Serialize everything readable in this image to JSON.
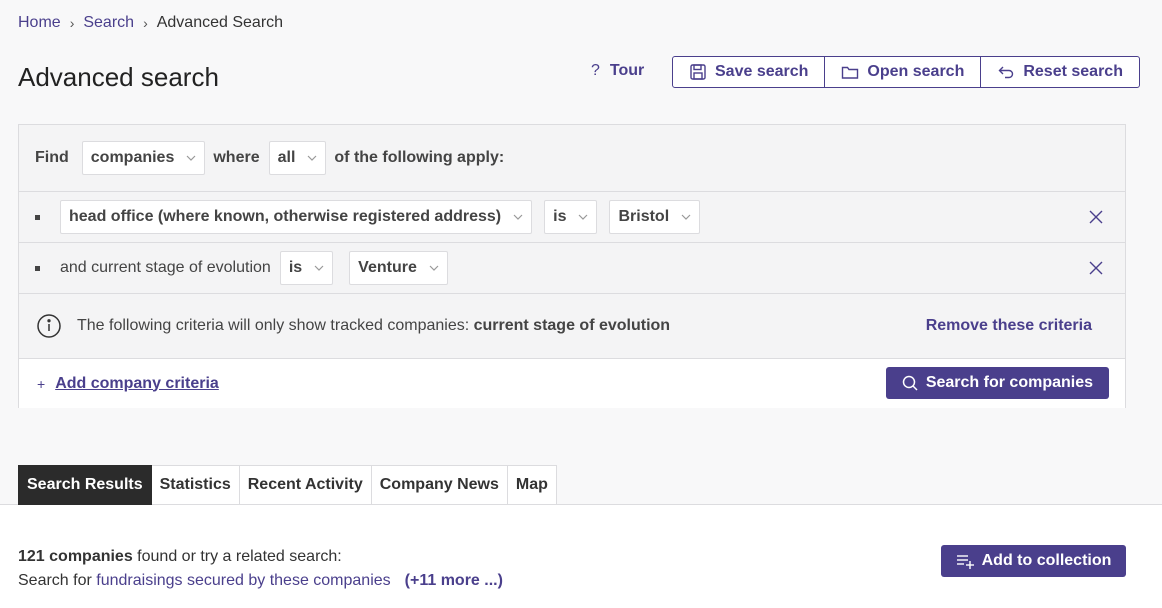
{
  "breadcrumb": {
    "home": "Home",
    "search": "Search",
    "current": "Advanced Search"
  },
  "page_title": "Advanced search",
  "toolbar": {
    "tour_label": "Tour",
    "save_label": "Save search",
    "open_label": "Open search",
    "reset_label": "Reset search"
  },
  "criteria": {
    "find_label": "Find",
    "entity_select": "companies",
    "where_label": "where",
    "match_select": "all",
    "apply_label": "of the following apply:",
    "rows": [
      {
        "field": "head office (where known, otherwise registered address)",
        "operator": "is",
        "value": "Bristol"
      },
      {
        "prefix": "and current stage of evolution",
        "operator": "is",
        "value": "Venture"
      }
    ],
    "notice_text": "The following criteria will only show tracked companies: ",
    "notice_bold": "current stage of evolution",
    "remove_label": "Remove these criteria",
    "add_label": "Add company criteria",
    "search_button": "Search for companies"
  },
  "tabs": [
    "Search Results",
    "Statistics",
    "Recent Activity",
    "Company News",
    "Map"
  ],
  "results": {
    "count": "121 companies",
    "found_text": " found or try a related search:",
    "search_for": "Search for ",
    "related_link": "fundraisings secured by these companies",
    "more_link": "(+11 more ...)",
    "collection_button": "Add to collection"
  },
  "colors": {
    "accent": "#4a3f8c",
    "active_tab": "#2b2b2b",
    "border": "#dcdcdf"
  }
}
